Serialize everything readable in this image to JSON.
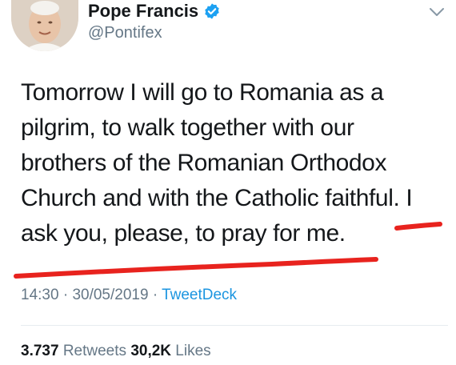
{
  "author": {
    "display_name": "Pope Francis",
    "handle": "@Pontifex",
    "verified": true,
    "avatar_icon": "avatar-photo"
  },
  "tweet": {
    "lines": [
      "Tomorrow I will go to Romania as a",
      "pilgrim, to walk together with our",
      "brothers of the Romanian Orthodox",
      "Church and with the Catholic faithful. I",
      "ask you, please, to pray for me."
    ]
  },
  "meta": {
    "time": "14:30",
    "sep1": "·",
    "date": "30/05/2019",
    "sep2": "·",
    "source": "TweetDeck"
  },
  "stats": {
    "retweets_count": "3.737",
    "retweets_label": "Retweets",
    "likes_count": "30,2K",
    "likes_label": "Likes"
  },
  "colors": {
    "text": "#14171a",
    "secondary": "#657786",
    "link": "#1b95e0",
    "verified_badge": "#1da1f2",
    "annotation_red": "#e8231e"
  },
  "icons": {
    "verified": "verified-badge-icon",
    "menu": "chevron-down-icon"
  }
}
